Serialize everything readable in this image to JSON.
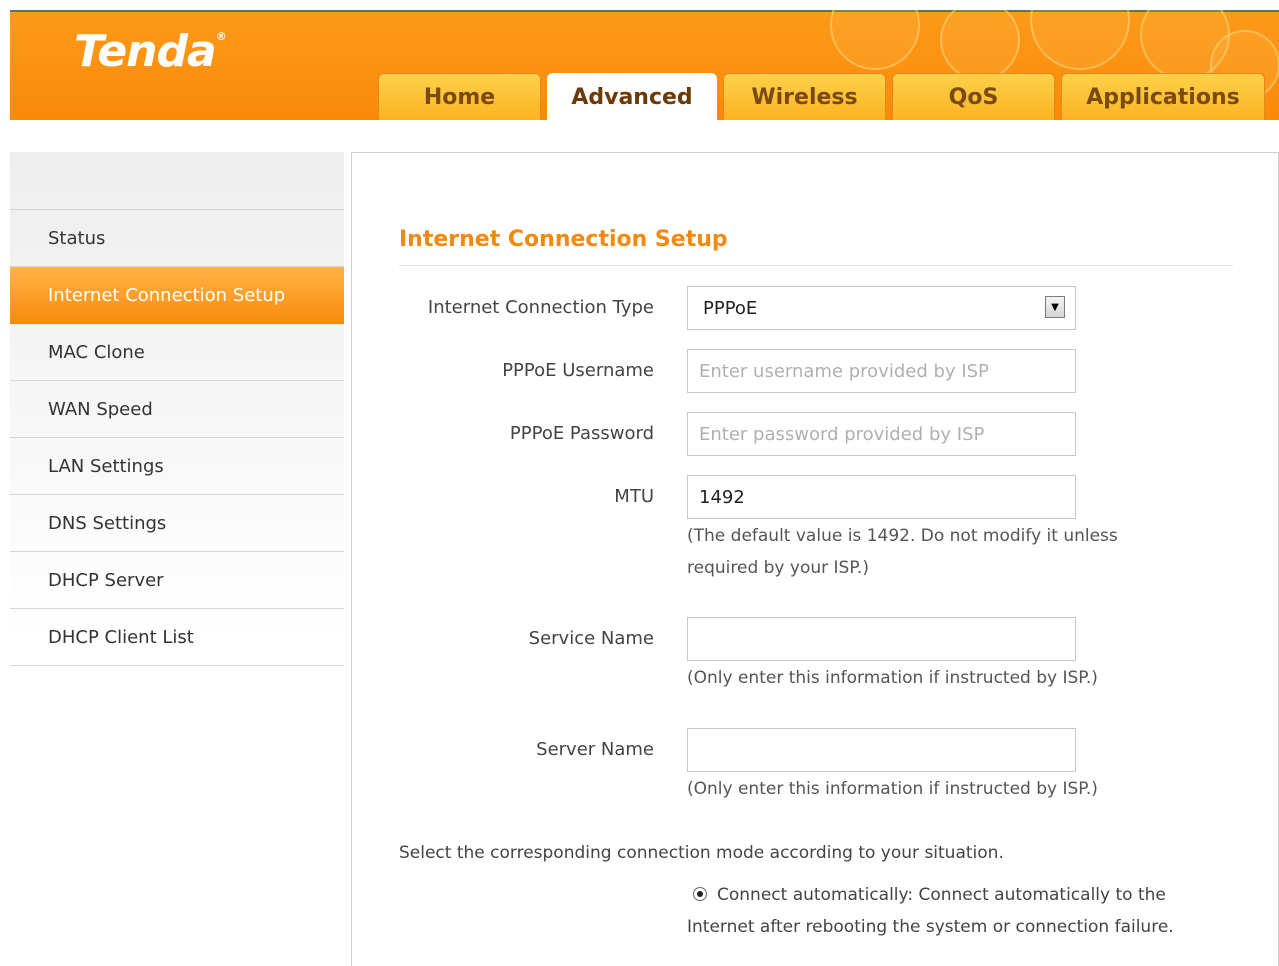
{
  "brand": {
    "logo_text": "Tenda",
    "registered_mark": "®"
  },
  "tabs": [
    {
      "label": "Home",
      "active": false
    },
    {
      "label": "Advanced",
      "active": true
    },
    {
      "label": "Wireless",
      "active": false
    },
    {
      "label": "QoS",
      "active": false
    },
    {
      "label": "Applications",
      "active": false
    }
  ],
  "sidebar": {
    "items": [
      {
        "label": "Status",
        "active": false
      },
      {
        "label": "Internet Connection Setup",
        "active": true
      },
      {
        "label": "MAC Clone",
        "active": false
      },
      {
        "label": "WAN Speed",
        "active": false
      },
      {
        "label": "LAN Settings",
        "active": false
      },
      {
        "label": "DNS Settings",
        "active": false
      },
      {
        "label": "DHCP Server",
        "active": false
      },
      {
        "label": "DHCP Client List",
        "active": false
      }
    ]
  },
  "main": {
    "title": "Internet Connection Setup",
    "connection_type": {
      "label": "Internet Connection Type",
      "value": "PPPoE",
      "arrow": "▼"
    },
    "username": {
      "label": "PPPoE Username",
      "value": "",
      "placeholder": "Enter username provided by ISP"
    },
    "password": {
      "label": "PPPoE Password",
      "value": "",
      "placeholder": "Enter password provided by ISP"
    },
    "mtu": {
      "label": "MTU",
      "value": "1492",
      "hint": "(The default value is 1492. Do not modify it unless required by your ISP.)"
    },
    "service_name": {
      "label": "Service Name",
      "value": "",
      "hint": "(Only enter this information if instructed by ISP.)"
    },
    "server_name": {
      "label": "Server Name",
      "value": "",
      "hint": "(Only enter this information if instructed by ISP.)"
    },
    "mode_intro": "Select the corresponding connection mode according to your situation.",
    "mode_auto": {
      "text": "Connect automatically: Connect automatically to the Internet after rebooting the system or connection failure.",
      "selected": true
    }
  },
  "colors": {
    "accent_orange": "#f98a0a",
    "title_orange": "#f38a10",
    "tab_yellow": "#fcb323"
  }
}
